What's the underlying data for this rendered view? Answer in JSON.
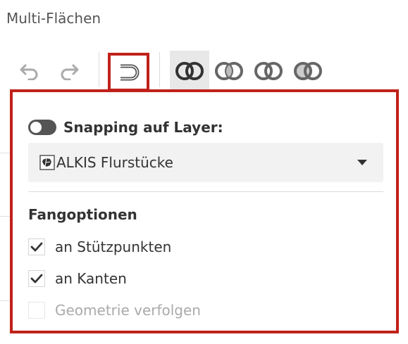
{
  "window": {
    "title": "Multi-Flächen"
  },
  "toolbar": {
    "undo_icon": "undo-icon",
    "redo_icon": "redo-icon",
    "snapping_icon": "magnet-snap-icon",
    "operations": [
      {
        "icon": "union-icon",
        "active": true
      },
      {
        "icon": "intersect-icon",
        "active": false
      },
      {
        "icon": "difference-icon",
        "active": false
      },
      {
        "icon": "symmetric-difference-icon",
        "active": false
      }
    ]
  },
  "panel": {
    "snapping_label": "Snapping auf Layer:",
    "snapping_enabled": false,
    "layer_select": {
      "value": "ALKIS Flurstücke",
      "icon": "parcel-layer-icon"
    },
    "section_title": "Fangoptionen",
    "options": [
      {
        "label": "an Stützpunkten",
        "checked": true,
        "disabled": false
      },
      {
        "label": "an Kanten",
        "checked": true,
        "disabled": false
      },
      {
        "label": "Geometrie verfolgen",
        "checked": false,
        "disabled": true
      }
    ]
  },
  "colors": {
    "highlight_border": "#c0211a",
    "active_bg": "#e8e8e8",
    "toggle_off": "#555555"
  }
}
